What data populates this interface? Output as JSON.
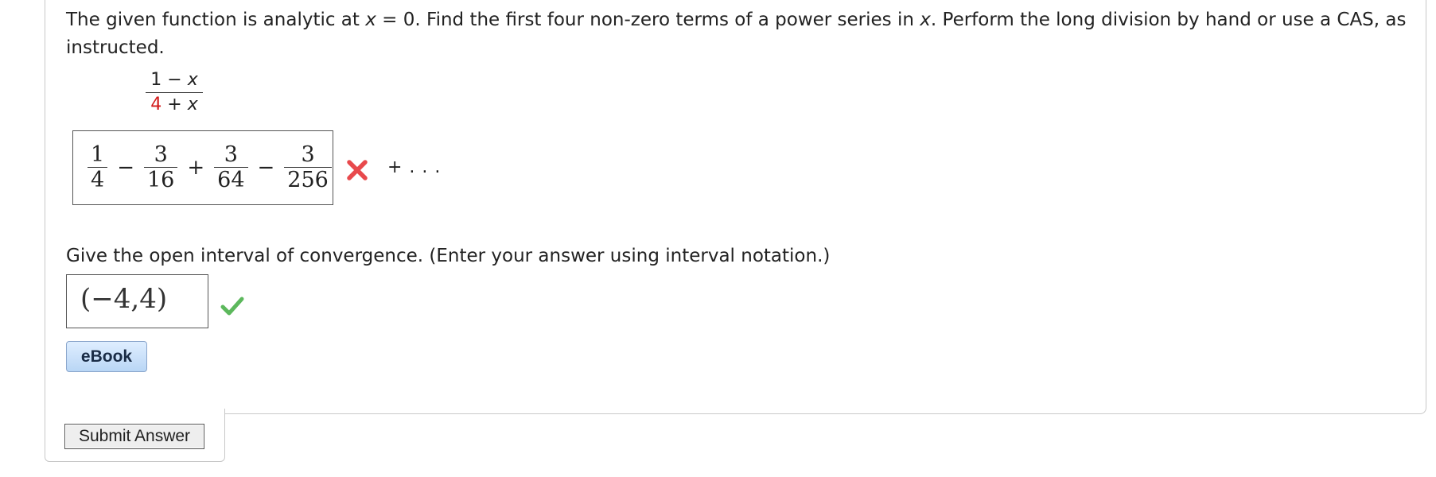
{
  "question": {
    "part1": "The given function is analytic at ",
    "var1": "x",
    "part2": " = 0.  Find the first four non-zero terms of a power series in ",
    "var2": "x",
    "part3": ". Perform the long division by hand or use a CAS, as instructed."
  },
  "function": {
    "numerator_a": "1 − ",
    "numerator_var": "x",
    "denominator_a": "4",
    "denominator_b": " + ",
    "denominator_var": "x",
    "denominator_a_color": "#d21a1a"
  },
  "series_answer": {
    "terms": [
      {
        "num": "1",
        "den": "4"
      },
      {
        "op": "−",
        "num": "3",
        "den": "16"
      },
      {
        "op": "+",
        "num": "3",
        "den": "64"
      },
      {
        "op": "−",
        "num": "3",
        "den": "256"
      }
    ],
    "status_icon": "x-mark-icon",
    "status_color": "#e8494c",
    "continuation": "+ . . ."
  },
  "convergence": {
    "prompt": "Give the open interval of convergence. (Enter your answer using interval notation.)",
    "answer": "(−4,4)",
    "status_icon": "check-mark-icon",
    "status_color": "#5cb85c"
  },
  "buttons": {
    "ebook": "eBook",
    "submit": "Submit Answer"
  }
}
